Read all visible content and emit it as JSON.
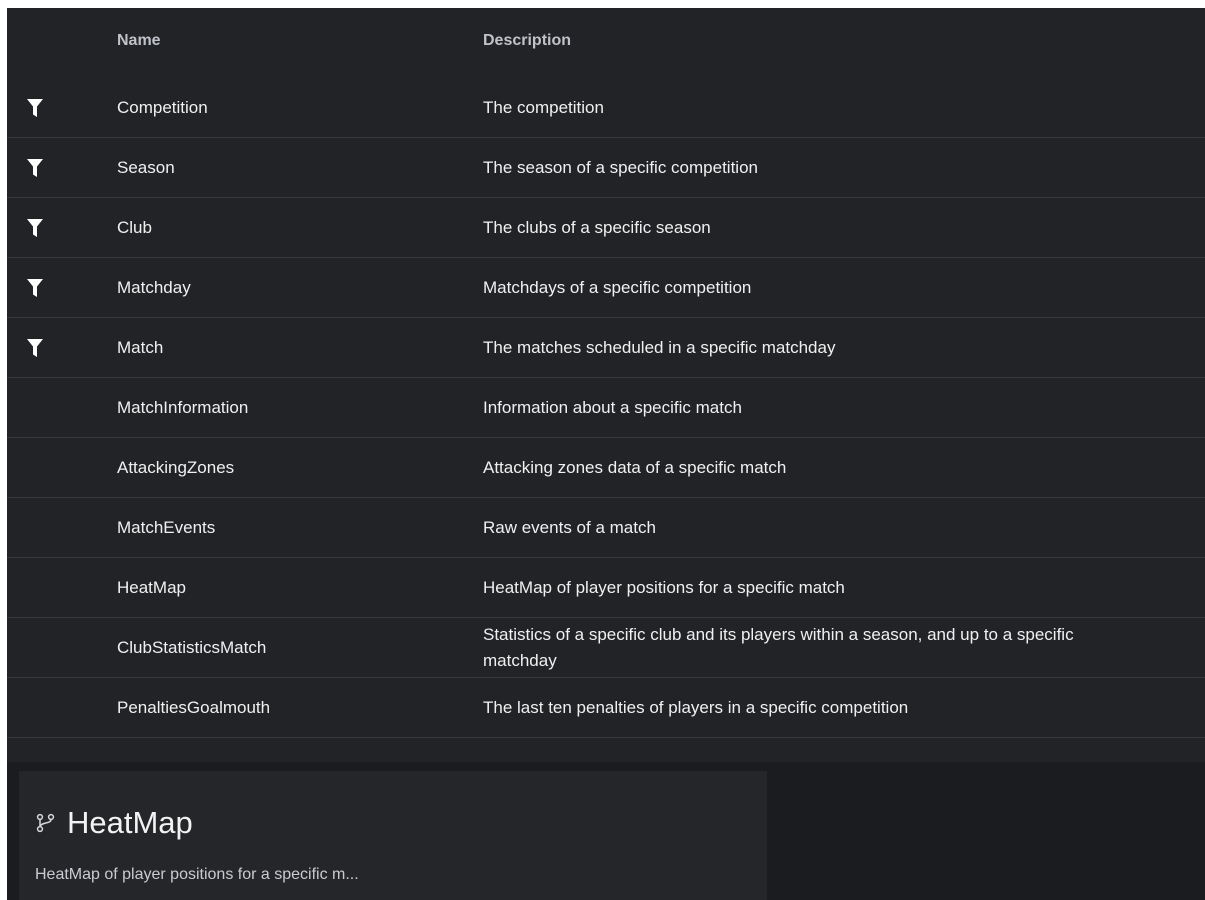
{
  "table": {
    "headers": {
      "name": "Name",
      "description": "Description"
    },
    "rows": [
      {
        "name": "Competition",
        "description": "The competition",
        "filter": true
      },
      {
        "name": "Season",
        "description": "The season of a specific competition",
        "filter": true
      },
      {
        "name": "Club",
        "description": "The clubs of a specific season",
        "filter": true
      },
      {
        "name": "Matchday",
        "description": "Matchdays of a specific competition",
        "filter": true
      },
      {
        "name": "Match",
        "description": "The matches scheduled in a specific matchday",
        "filter": true
      },
      {
        "name": "MatchInformation",
        "description": "Information about a specific match",
        "filter": false
      },
      {
        "name": "AttackingZones",
        "description": "Attacking zones data of a specific match",
        "filter": false
      },
      {
        "name": "MatchEvents",
        "description": "Raw events of a match",
        "filter": false
      },
      {
        "name": "HeatMap",
        "description": "HeatMap of player positions for a specific match",
        "filter": false
      },
      {
        "name": "ClubStatisticsMatch",
        "description": "Statistics of a specific club and its players within a season, and up to a specific matchday",
        "filter": false
      },
      {
        "name": "PenaltiesGoalmouth",
        "description": "The last ten penalties of players in a specific competition",
        "filter": false
      }
    ]
  },
  "card": {
    "icon": "fork-icon",
    "title": "HeatMap",
    "description": "HeatMap of player positions for a specific m..."
  },
  "colors": {
    "background": "#222327",
    "text": "#f0f0f0",
    "header_text": "#bfc2c8",
    "divider": "#35373c"
  }
}
